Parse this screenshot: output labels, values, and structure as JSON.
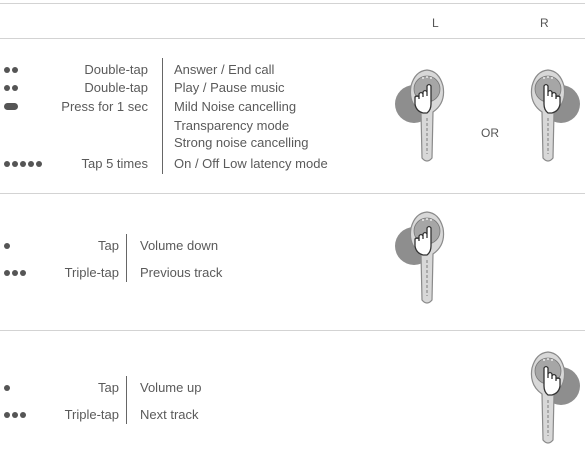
{
  "header": {
    "left_label": "L",
    "right_label": "R"
  },
  "section1": {
    "rows": [
      {
        "dots": "2",
        "gesture": "Double-tap",
        "action": "Answer / End call"
      },
      {
        "dots": "2",
        "gesture": "Double-tap",
        "action": "Play / Pause music"
      },
      {
        "dots": "pill",
        "gesture": "Press for 1 sec",
        "action": "Mild Noise cancelling"
      },
      {
        "action": "Transparency mode"
      },
      {
        "action": "Strong noise cancelling"
      },
      {
        "dots": "5",
        "gesture": "Tap 5 times",
        "action": "On / Off  Low latency mode"
      }
    ],
    "or_label": "OR"
  },
  "section2": {
    "rows": [
      {
        "dots": "1",
        "gesture": "Tap",
        "action": "Volume down"
      },
      {
        "dots": "3",
        "gesture": "Triple-tap",
        "action": "Previous track"
      }
    ]
  },
  "section3": {
    "rows": [
      {
        "dots": "1",
        "gesture": "Tap",
        "action": "Volume up"
      },
      {
        "dots": "3",
        "gesture": "Triple-tap",
        "action": "Next track"
      }
    ]
  },
  "icons": [
    "earbud-left-icon",
    "earbud-right-icon",
    "tap-hand-icon"
  ]
}
